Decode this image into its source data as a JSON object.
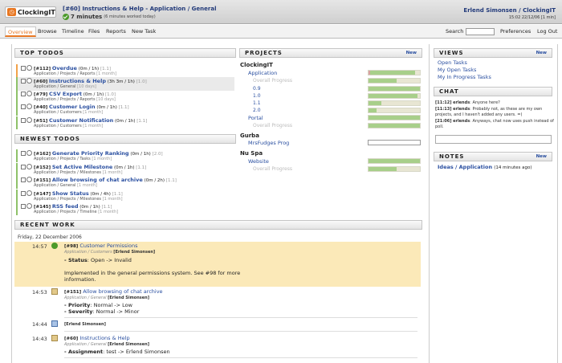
{
  "header": {
    "logo": "ClockingIT",
    "task_title": "[#60] Instructions & Help - Application / General",
    "task_time": "7 minutes",
    "task_time_note": "(6 minutes worked today)",
    "user": "Erlend Simonsen / ClockingIT",
    "clock": "15:02 22/12/06 [1 min]"
  },
  "nav": {
    "items": [
      "Overview",
      "Browse",
      "Timeline",
      "Files",
      "Reports",
      "New Task"
    ],
    "search_label": "Search",
    "preferences": "Preferences",
    "logout": "Log Out"
  },
  "top_todos": {
    "title": "TOP TODOS",
    "items": [
      {
        "id": "[#112]",
        "name": "Overdue",
        "est": "(0m / 1h)",
        "last": "[1.1]",
        "path": "Application / Projects / Reports",
        "ago": "[1 month]"
      },
      {
        "id": "[#60]",
        "name": "Instructions & Help",
        "est": "(3h 3m / 1h)",
        "last": "[1.0]",
        "path": "Application / General",
        "ago": "[10 days]"
      },
      {
        "id": "[#79]",
        "name": "CSV Export",
        "est": "(0m / 1h)",
        "last": "[1.0]",
        "path": "Application / Projects / Reports",
        "ago": "[10 days]"
      },
      {
        "id": "[#40]",
        "name": "Customer Login",
        "est": "(0m / 1h)",
        "last": "[1.1]",
        "path": "Application / Customers",
        "ago": "[1 month]"
      },
      {
        "id": "[#51]",
        "name": "Customer Notification",
        "est": "(0m / 1h)",
        "last": "[1.1]",
        "path": "Application / Customers",
        "ago": "[1 month]"
      }
    ]
  },
  "newest_todos": {
    "title": "NEWEST TODOS",
    "items": [
      {
        "id": "[#162]",
        "name": "Generate Priority Ranking",
        "est": "(0m / 1h)",
        "last": "[2.0]",
        "path": "Application / Projects / Tasks",
        "ago": "[1 month]"
      },
      {
        "id": "[#152]",
        "name": "Set Active Milestone",
        "est": "(0m / 1h)",
        "last": "[1.1]",
        "path": "Application / Projects / Milestones",
        "ago": "[1 month]"
      },
      {
        "id": "[#151]",
        "name": "Allow browsing of chat archive",
        "est": "(0m / 2h)",
        "last": "[1.1]",
        "path": "Application / General",
        "ago": "[1 month]"
      },
      {
        "id": "[#147]",
        "name": "Show Status",
        "est": "(0m / 4h)",
        "last": "[1.1]",
        "path": "Application / Projects / Milestones",
        "ago": "[1 month]"
      },
      {
        "id": "[#145]",
        "name": "RSS feed",
        "est": "(0m / 1h)",
        "last": "[1.1]",
        "path": "Application / Projects / Timeline",
        "ago": "[1 month]"
      }
    ]
  },
  "recent_work": {
    "title": "RECENT WORK",
    "date": "Friday, 22 December 2006",
    "entries": [
      {
        "time": "14:57",
        "id": "[#98]",
        "name": "Customer Permissions",
        "path": "Application / Customers",
        "user": "[Erlend Simonsen]",
        "status_label": "- Status",
        "status_value": ": Open -> Invalid",
        "body1": "Implemented in the general permissions system. See #98 for more",
        "body2": "information."
      },
      {
        "time": "14:53",
        "id": "[#151]",
        "name": "Allow browsing of chat archive",
        "path": "Application / General",
        "user": "[Erlend Simonsen]",
        "c1_label": "- Priority",
        "c1_value": ": Normal -> Low",
        "c2_label": "- Severity",
        "c2_value": ": Normal -> Minor"
      },
      {
        "time": "14:44",
        "user": "[Erlend Simonsen]"
      },
      {
        "time": "14:43",
        "id": "[#60]",
        "name": "Instructions & Help",
        "path": "Application / General",
        "user": "[Erlend Simonsen]",
        "c1_label": "- Assignment",
        "c1_value": ": test -> Erlend Simonsen"
      }
    ]
  },
  "projects": {
    "title": "PROJECTS",
    "new_label": "New",
    "overall_label": "Overall Progress",
    "groups": [
      {
        "customer": "ClockingIT",
        "projects": [
          {
            "name": "Application",
            "progress": 0.9,
            "milestones": [
              {
                "name": "0.9",
                "progress": 1.0
              },
              {
                "name": "1.0",
                "progress": 0.95
              },
              {
                "name": "1.1",
                "progress": 0.25
              },
              {
                "name": "2.0",
                "progress": 0.15
              }
            ],
            "overall": 0.55
          },
          {
            "name": "Portal",
            "progress": 1.0,
            "overall": 1.0
          }
        ]
      },
      {
        "customer": "Gurba",
        "projects": [
          {
            "name": "MrsFudges Prog",
            "progress": 0.0
          }
        ]
      },
      {
        "customer": "Nu Spa",
        "projects": [
          {
            "name": "Website",
            "progress": 1.0,
            "overall": 0.55
          }
        ]
      }
    ]
  },
  "views": {
    "title": "VIEWS",
    "new_label": "New",
    "items": [
      "Open Tasks",
      "My Open Tasks",
      "My In Progress Tasks"
    ]
  },
  "chat": {
    "title": "CHAT",
    "lines": [
      {
        "time": "[11:12]",
        "user": "erlends",
        "text": ": Anyone here?"
      },
      {
        "time": "[11:13]",
        "user": "erlends",
        "text": ": Probably not, as these are my own projects, and I haven't added any users. =)"
      },
      {
        "time": "[21:06]",
        "user": "erlends",
        "text": ": Anyways, chat now uses push instead of poll."
      }
    ]
  },
  "notes": {
    "title": "NOTES",
    "new_label": "New",
    "items": [
      {
        "name": "Ideas / Application",
        "ago": "(14 minutes ago)"
      }
    ]
  },
  "colors": {
    "accent": "#e87722",
    "link": "#2a4fa0",
    "progress": "#a8cf8a",
    "highlight": "#fbe9b8"
  }
}
